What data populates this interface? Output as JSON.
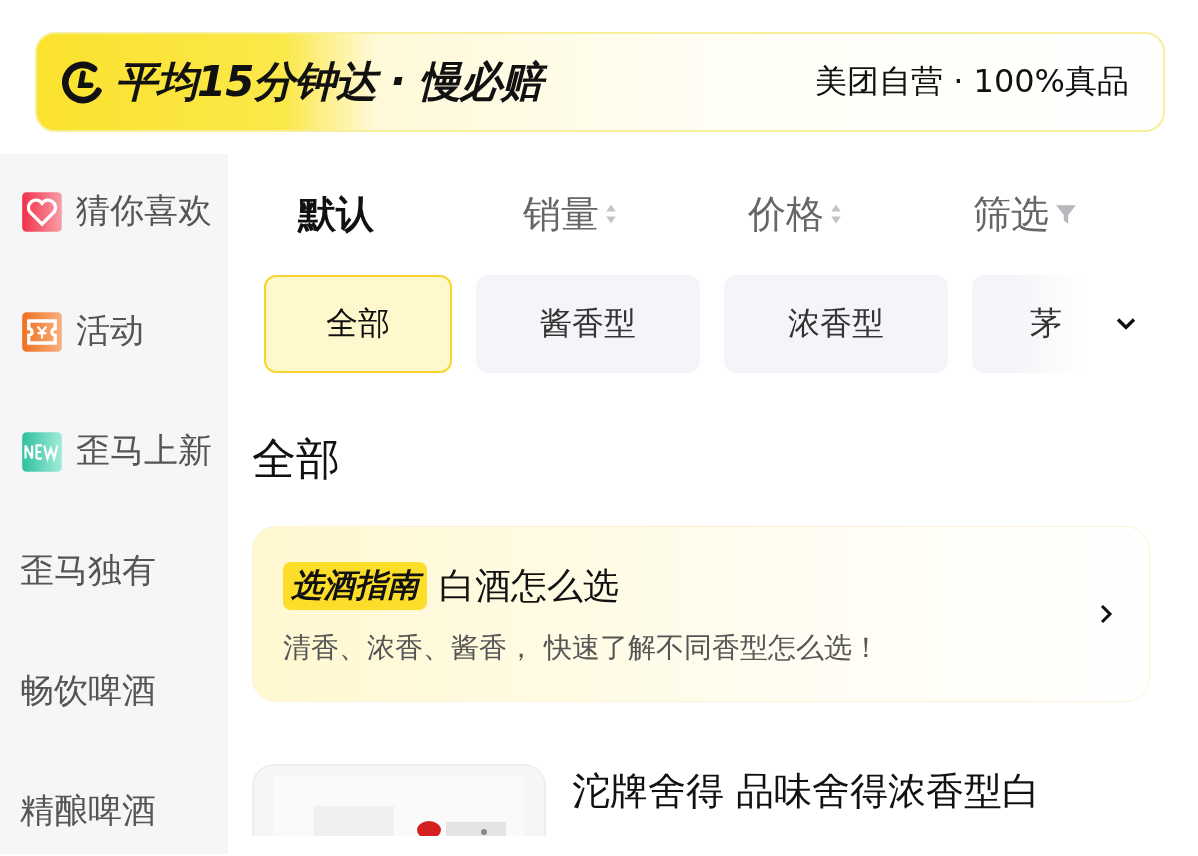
{
  "banner": {
    "slogan": "平均15分钟达 · 慢必赔",
    "promise": "美团自营 · 100%真品"
  },
  "sidebar": {
    "items": [
      {
        "label": "猜你喜欢",
        "kind": "heart",
        "selected": false
      },
      {
        "label": "活动",
        "kind": "ticket",
        "selected": false
      },
      {
        "label": "歪马上新",
        "kind": "new",
        "selected": false
      },
      {
        "label": "歪马独有",
        "kind": "text",
        "selected": false
      },
      {
        "label": "畅饮啤酒",
        "kind": "text",
        "selected": false
      },
      {
        "label": "精酿啤酒",
        "kind": "text",
        "selected": false
      }
    ]
  },
  "sort_tabs": [
    {
      "label": "默认",
      "kind": "plain",
      "selected": true
    },
    {
      "label": "销量",
      "kind": "sortable",
      "selected": false
    },
    {
      "label": "价格",
      "kind": "sortable",
      "selected": false
    },
    {
      "label": "筛选",
      "kind": "filter",
      "selected": false
    }
  ],
  "chips": [
    {
      "label": "全部",
      "selected": true
    },
    {
      "label": "酱香型",
      "selected": false
    },
    {
      "label": "浓香型",
      "selected": false
    },
    {
      "label": "茅",
      "selected": false
    }
  ],
  "section_title": "全部",
  "guide": {
    "tag": "选酒指南",
    "title": "白酒怎么选",
    "subtitle": "清香、浓香、酱香， 快速了解不同香型怎么选！"
  },
  "product": {
    "title": "沱牌舍得 品味舍得浓香型白"
  }
}
